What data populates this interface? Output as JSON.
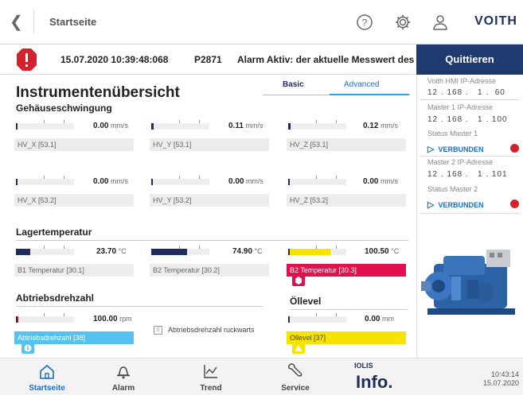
{
  "header": {
    "breadcrumb": "Startseite",
    "brand": "VOITH"
  },
  "alarm": {
    "timestamp": "15.07.2020 10:39:48:068",
    "code": "P2871",
    "message": "Alarm Aktiv: der aktuelle Messwert des",
    "ack_label": "Quittieren"
  },
  "panel": {
    "voith_label": "Voith HMI IP-Adresse",
    "voith_ip": "12 . 168 .   1 .  60",
    "m1_label": "Master 1 IP-Adresse",
    "m1_ip": "12 . 168 .   1 . 100",
    "s1_label": "Status Master 1",
    "s1_value": "VERBUNDEN",
    "m2_label": "Master 2 IP-Adresse",
    "m2_ip": "12 . 168 .   1 . 101",
    "s2_label": "Status Master 2",
    "s2_value": "VERBUNDEN"
  },
  "page": {
    "title": "Instrumentenübersicht",
    "tab_basic": "Basic",
    "tab_advanced": "Advanced"
  },
  "vib": {
    "title": "Gehäuseschwingung",
    "g": [
      {
        "value": "0.00",
        "unit": "mm/s",
        "label": "HV_X [53.1]",
        "level": 0.0
      },
      {
        "value": "0.11",
        "unit": "mm/s",
        "label": "HV_Y [53.1]",
        "level": 0.02
      },
      {
        "value": "0.12",
        "unit": "mm/s",
        "label": "HV_Z [53.1]",
        "level": 0.02
      },
      {
        "value": "0.00",
        "unit": "mm/s",
        "label": "HV_X [53.2]",
        "level": 0.0
      },
      {
        "value": "0.00",
        "unit": "mm/s",
        "label": "HV_Y [53.2]",
        "level": 0.0
      },
      {
        "value": "0.00",
        "unit": "mm/s",
        "label": "HV_Z [53.2]",
        "level": 0.0
      }
    ]
  },
  "temp": {
    "title": "Lagertemperatur",
    "g": [
      {
        "value": "23.70",
        "unit": "°C",
        "label": "B1 Temperatur [30.1]",
        "level": 0.22
      },
      {
        "value": "74.90",
        "unit": "°C",
        "label": "B2 Temperatur [30.2]",
        "level": 0.6
      },
      {
        "value": "100.50",
        "unit": "°C",
        "label": "B2 Temperatur [30.3]",
        "level": 0.72
      }
    ]
  },
  "speed": {
    "title": "Abtriebsdrehzahl",
    "value": "100.00",
    "unit": "rpm",
    "label": "Abtriebsdrehzahl [38]",
    "level": 0.02,
    "reverse_label": "Abtriebsdrehzahl ruckwarts"
  },
  "oil": {
    "title": "Öllevel",
    "value": "0.00",
    "unit": "mm",
    "label": "Ollevel [37]",
    "level": 0.0
  },
  "nav": {
    "home": "Startseite",
    "alarm": "Alarm",
    "trend": "Trend",
    "service": "Service",
    "iolis": "IOLIS",
    "info": "Info.",
    "time": "10:43:14",
    "date": "15.07.2020"
  },
  "colors": {
    "accent": "#1a6ec8",
    "navy": "#1f2d5c",
    "alarm_red": "#d5202e",
    "warn_yellow": "#f7e300"
  }
}
